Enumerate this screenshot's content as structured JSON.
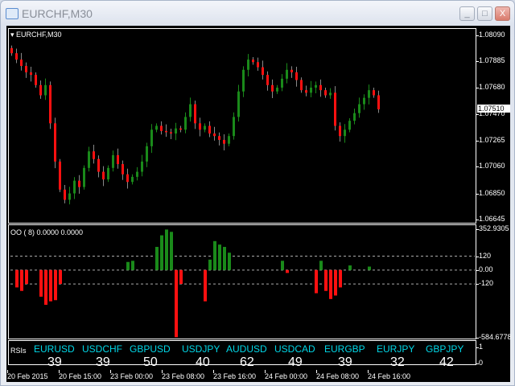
{
  "window": {
    "title": "EURCHF,M30",
    "min": "_",
    "max": "□",
    "close": "X"
  },
  "chart": {
    "symbol_label": "EURCHF,M30",
    "price_axis": [
      {
        "v": "1.08090",
        "p": 1.0809
      },
      {
        "v": "1.07885",
        "p": 1.07885
      },
      {
        "v": "1.07680",
        "p": 1.0768
      },
      {
        "v": "1.07470",
        "p": 1.0747
      },
      {
        "v": "1.07265",
        "p": 1.07265
      },
      {
        "v": "1.07060",
        "p": 1.0706
      },
      {
        "v": "1.06850",
        "p": 1.0685
      },
      {
        "v": "1.06645",
        "p": 1.06645
      }
    ],
    "current_price": "1.07510",
    "colors": {
      "bull": "#1a8a1a",
      "bear": "#ff1010",
      "background": "#000000",
      "rsi_pair": "#00d8e8"
    },
    "closes": [
      1.0795,
      1.079,
      1.0785,
      1.078,
      1.0778,
      1.077,
      1.0762,
      1.077,
      1.074,
      1.071,
      1.0688,
      1.068,
      1.0685,
      1.0695,
      1.069,
      1.0705,
      1.0718,
      1.0712,
      1.0702,
      1.0696,
      1.0705,
      1.0715,
      1.0708,
      1.07,
      1.0694,
      1.0698,
      1.0702,
      1.071,
      1.0722,
      1.0735,
      1.0738,
      1.0734,
      1.0733,
      1.0732,
      1.0736,
      1.0735,
      1.0745,
      1.0755,
      1.074,
      1.0735,
      1.0738,
      1.0732,
      1.073,
      1.0727,
      1.0724,
      1.073,
      1.0745,
      1.0765,
      1.0782,
      1.079,
      1.0788,
      1.0784,
      1.0778,
      1.077,
      1.0765,
      1.0768,
      1.0775,
      1.0782,
      1.078,
      1.0774,
      1.0766,
      1.0764,
      1.0768,
      1.077,
      1.0766,
      1.0762,
      1.0764,
      1.0738,
      1.073,
      1.0735,
      1.0742,
      1.0748,
      1.0755,
      1.076,
      1.0766,
      1.0762,
      1.0751
    ],
    "oscillator": {
      "label": "OO ( 8) 0.0000 0.0000",
      "axis": [
        {
          "v": "352.9305",
          "val": 352.93
        },
        {
          "v": "120",
          "val": 120
        },
        {
          "v": "0.00",
          "val": 0
        },
        {
          "v": "-120",
          "val": -120
        },
        {
          "v": "-584.6778",
          "val": -584.68
        }
      ],
      "range": [
        -584.68,
        352.93
      ],
      "levels": [
        120,
        0,
        -120
      ],
      "bars": [
        [
          1,
          -150
        ],
        [
          2,
          -180
        ],
        [
          3,
          -120
        ],
        [
          6,
          -230
        ],
        [
          7,
          -300
        ],
        [
          8,
          -270
        ],
        [
          9,
          -260
        ],
        [
          10,
          -120
        ],
        [
          24,
          70
        ],
        [
          25,
          80
        ],
        [
          30,
          200
        ],
        [
          31,
          300
        ],
        [
          32,
          350
        ],
        [
          33,
          330
        ],
        [
          34,
          -580
        ],
        [
          35,
          -120
        ],
        [
          40,
          -270
        ],
        [
          41,
          90
        ],
        [
          42,
          250
        ],
        [
          43,
          220
        ],
        [
          44,
          200
        ],
        [
          45,
          150
        ],
        [
          56,
          80
        ],
        [
          57,
          -25
        ],
        [
          63,
          -200
        ],
        [
          64,
          80
        ],
        [
          65,
          -180
        ],
        [
          66,
          -250
        ],
        [
          67,
          -220
        ],
        [
          68,
          -150
        ],
        [
          70,
          40
        ],
        [
          74,
          30
        ]
      ]
    },
    "rsi_panel": {
      "label": "RSIs",
      "pairs": [
        {
          "name": "EURUSD",
          "value": "39"
        },
        {
          "name": "USDCHF",
          "value": "39"
        },
        {
          "name": "GBPUSD",
          "value": "50"
        },
        {
          "name": "USDJPY",
          "value": "40"
        },
        {
          "name": "AUDUSD",
          "value": "62"
        },
        {
          "name": "USDCAD",
          "value": "49"
        },
        {
          "name": "EURGBP",
          "value": "39"
        },
        {
          "name": "EURJPY",
          "value": "32"
        },
        {
          "name": "GBPJPY",
          "value": "42"
        }
      ],
      "axis_top": "1",
      "axis_bottom": "0"
    },
    "time_axis": [
      "20 Feb 2015",
      "20 Feb 15:00",
      "23 Feb 00:00",
      "23 Feb 08:00",
      "23 Feb 16:00",
      "24 Feb 00:00",
      "24 Feb 08:00",
      "24 Feb 16:00"
    ]
  }
}
